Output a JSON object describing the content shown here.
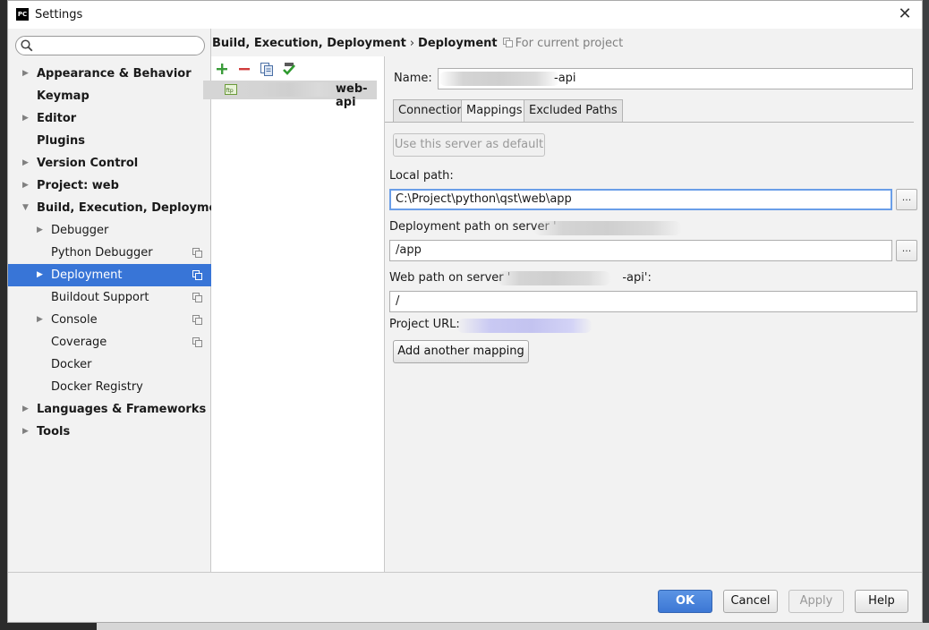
{
  "window": {
    "title": "Settings",
    "close_glyph": "✕",
    "app_icon_text": "PC"
  },
  "search": {
    "placeholder": "",
    "value": ""
  },
  "sidebar": {
    "items": [
      {
        "label": "Appearance & Behavior",
        "expandable": true,
        "bold": true
      },
      {
        "label": "Keymap",
        "expandable": false,
        "bold": true
      },
      {
        "label": "Editor",
        "expandable": true,
        "bold": true
      },
      {
        "label": "Plugins",
        "expandable": false,
        "bold": true
      },
      {
        "label": "Version Control",
        "expandable": true,
        "bold": true
      },
      {
        "label": "Project: web",
        "expandable": true,
        "bold": true
      },
      {
        "label": "Build, Execution, Deployment",
        "expandable": true,
        "expanded": true,
        "bold": true
      },
      {
        "label": "Debugger",
        "expandable": true,
        "child": true
      },
      {
        "label": "Python Debugger",
        "child": true,
        "project_scoped": true
      },
      {
        "label": "Deployment",
        "expandable": true,
        "child": true,
        "selected": true,
        "project_scoped": true
      },
      {
        "label": "Buildout Support",
        "child": true,
        "project_scoped": true
      },
      {
        "label": "Console",
        "expandable": true,
        "child": true,
        "project_scoped": true
      },
      {
        "label": "Coverage",
        "child": true,
        "project_scoped": true
      },
      {
        "label": "Docker",
        "child": true
      },
      {
        "label": "Docker Registry",
        "child": true
      },
      {
        "label": "Languages & Frameworks",
        "expandable": true,
        "bold": true
      },
      {
        "label": "Tools",
        "expandable": true,
        "bold": true
      }
    ]
  },
  "breadcrumb": {
    "parent": "Build, Execution, Deployment",
    "separator": "›",
    "current": "Deployment",
    "note": "For current project"
  },
  "servers": {
    "toolbar": [
      "add-icon",
      "remove-icon",
      "copy-icon",
      "check-icon"
    ],
    "items": [
      {
        "label_visible": "web-api",
        "type": "ftp"
      }
    ]
  },
  "form": {
    "name_label": "Name:",
    "name_value_visible": "-api",
    "tabs": [
      "Connection",
      "Mappings",
      "Excluded Paths"
    ],
    "active_tab": "Mappings",
    "use_default_button": "Use this server as default",
    "local_path_label": "Local path:",
    "local_path_value": "C:\\Project\\python\\qst\\web\\app",
    "deployment_path_label": "Deployment path on server '",
    "deployment_path_value": "/app",
    "web_path_label_prefix": "Web path on server '",
    "web_path_label_suffix": "-api':",
    "web_path_value": "/",
    "project_url_label": "Project URL:",
    "add_mapping_button": "Add another mapping",
    "browse_glyph": "..."
  },
  "footer": {
    "ok": "OK",
    "cancel": "Cancel",
    "apply": "Apply",
    "help": "Help"
  },
  "colors": {
    "selection": "#3875d7",
    "primary_button": "#3c77d4",
    "focus_border": "#6a9ee8"
  }
}
